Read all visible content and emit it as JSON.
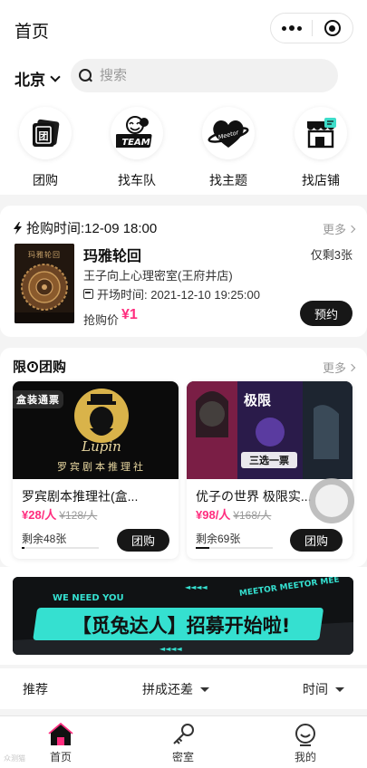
{
  "header": {
    "title": "首页",
    "city": "北京",
    "search_placeholder": "搜索"
  },
  "categories": [
    {
      "label": "团购",
      "icon": "group-buy-icon"
    },
    {
      "label": "找车队",
      "icon": "team-icon"
    },
    {
      "label": "找主题",
      "icon": "theme-icon"
    },
    {
      "label": "找店铺",
      "icon": "store-icon"
    }
  ],
  "flash_sale": {
    "heading": "抢购时间:12-09 18:00",
    "more": "更多",
    "poster_text": "玛雅轮回",
    "name": "玛雅轮回",
    "stock_left": "仅剩3张",
    "shop": "王子向上心理密室(王府井店)",
    "start_time": "开场时间:  2021-12-10 19:25:00",
    "price_label": "抢购价",
    "price": "¥1",
    "book_button": "预约"
  },
  "group_buy": {
    "heading_pre": "限",
    "heading_post": "团购",
    "more": "更多",
    "cards": [
      {
        "tag": "盒装通票",
        "image_logo_text": "Lupin",
        "image_sub_text": "罗宾剧本推理社",
        "name": "罗宾剧本推理社(盒...",
        "price": "¥28/人",
        "original_price": "¥128/人",
        "remain": "剩余48张",
        "progress": 0.03,
        "button": "团购"
      },
      {
        "image_text_1": "极限",
        "image_text_2": "三选一票",
        "name": "优子の世界 极限实...",
        "price": "¥98/人",
        "original_price": "¥168/人",
        "remain": "剩余69张",
        "progress": 0.18,
        "button": "团购"
      }
    ]
  },
  "banner": {
    "top_text": "WE NEED YOU",
    "main_text": "【觅兔达人】招募开始啦!",
    "side_text": "MEETOR MEETOR MEE"
  },
  "filters": [
    {
      "label": "推荐"
    },
    {
      "label": "拼成还差"
    },
    {
      "label": "时间"
    }
  ],
  "tabbar": [
    {
      "label": "首页",
      "icon": "home-icon",
      "active": true
    },
    {
      "label": "密室",
      "icon": "key-icon",
      "active": false
    },
    {
      "label": "我的",
      "icon": "profile-icon",
      "active": false
    }
  ],
  "watermark": "众测猫",
  "colors": {
    "accent": "#ff2d7e",
    "dark": "#171717",
    "brand_teal": "#35e0d0"
  }
}
